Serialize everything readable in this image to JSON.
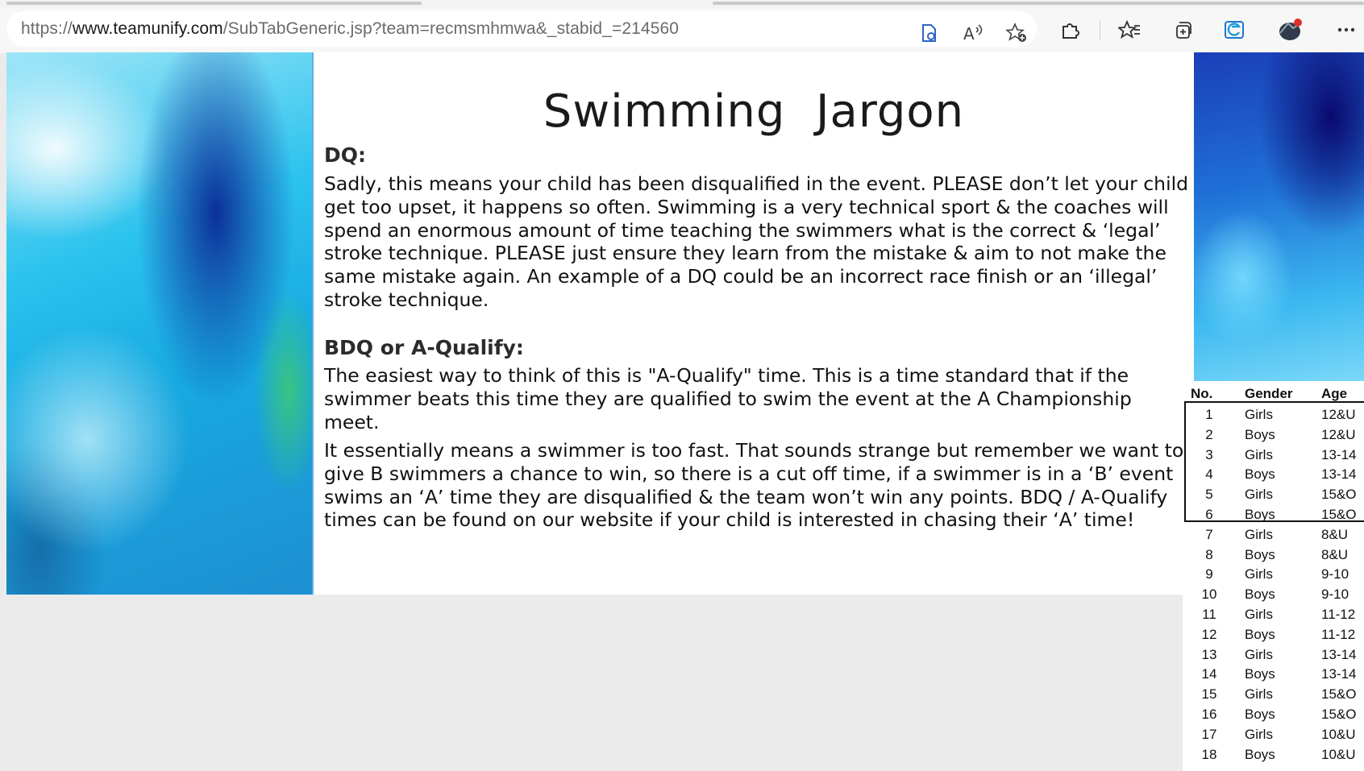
{
  "browser": {
    "url_prefix": "https://",
    "url_host": "www.teamunify.com",
    "url_path": "/SubTabGeneric.jsp?team=recmsmhmwa&_stabid_=214560",
    "icons": [
      "reading-view-icon",
      "read-aloud-icon",
      "add-favorite-icon",
      "extensions-icon",
      "favorites-icon",
      "collections-icon",
      "edge-bar-icon",
      "profile-icon",
      "more-menu-icon"
    ]
  },
  "page": {
    "title": "Swimming  Jargon",
    "sections": [
      {
        "heading": "DQ:",
        "paragraphs": [
          "Sadly, this means your child has been disqualified in the event.  PLEASE don’t let your child get too upset, it happens so often.  Swimming is a very technical sport & the coaches will spend an enormous amount of time teaching the swimmers what is the correct & ‘legal’ stroke technique.  PLEASE just ensure they learn from the mistake & aim to not make the same mistake again.  An example of a DQ could be an incorrect race finish or an ‘illegal’ stroke technique."
        ]
      },
      {
        "heading": "BDQ or A-Qualify:",
        "paragraphs": [
          "The easiest way to think of this is \"A-Qualify\" time. This is a time standard that if the swimmer beats this time they are qualified to swim the event at the A Championship meet.",
          "It essentially means a swimmer is too fast.  That sounds strange but remember we want to give B swimmers a chance to win, so there is a cut off time, if a swimmer is in a ‘B’ event swims an ‘A’ time they are disqualified & the team won’t win any points. BDQ / A-Qualify times can be found on our website if your child is interested in chasing their ‘A’ time!"
        ]
      }
    ]
  },
  "age_table": {
    "headers": {
      "no": "No.",
      "gender": "Gender",
      "age": "Age"
    },
    "rows": [
      {
        "no": "1",
        "gender": "Girls",
        "age": "12&U"
      },
      {
        "no": "2",
        "gender": "Boys",
        "age": "12&U"
      },
      {
        "no": "3",
        "gender": "Girls",
        "age": "13-14"
      },
      {
        "no": "4",
        "gender": "Boys",
        "age": "13-14"
      },
      {
        "no": "5",
        "gender": "Girls",
        "age": "15&O"
      },
      {
        "no": "6",
        "gender": "Boys",
        "age": "15&O"
      },
      {
        "no": "7",
        "gender": "Girls",
        "age": "8&U"
      },
      {
        "no": "8",
        "gender": "Boys",
        "age": "8&U"
      },
      {
        "no": "9",
        "gender": "Girls",
        "age": "9-10"
      },
      {
        "no": "10",
        "gender": "Boys",
        "age": "9-10"
      },
      {
        "no": "11",
        "gender": "Girls",
        "age": "11-12"
      },
      {
        "no": "12",
        "gender": "Boys",
        "age": "11-12"
      },
      {
        "no": "13",
        "gender": "Girls",
        "age": "13-14"
      },
      {
        "no": "14",
        "gender": "Boys",
        "age": "13-14"
      },
      {
        "no": "15",
        "gender": "Girls",
        "age": "15&O"
      },
      {
        "no": "16",
        "gender": "Boys",
        "age": "15&O"
      },
      {
        "no": "17",
        "gender": "Girls",
        "age": "10&U"
      },
      {
        "no": "18",
        "gender": "Boys",
        "age": "10&U"
      }
    ]
  }
}
